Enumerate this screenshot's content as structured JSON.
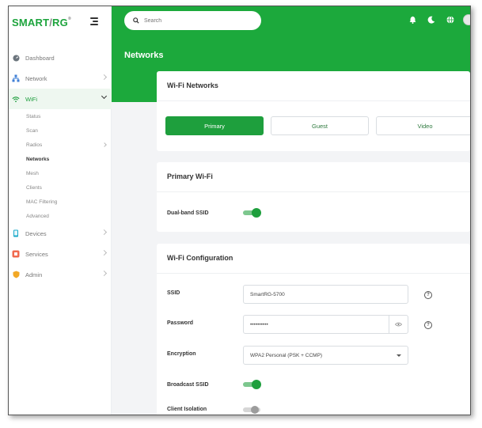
{
  "brand": {
    "logo_main": "SMART",
    "logo_slash": "/",
    "logo_tail": "RG",
    "logo_mark": "®"
  },
  "search": {
    "placeholder": "Search"
  },
  "page": {
    "title": "Networks"
  },
  "sidebar": {
    "items": [
      {
        "label": "Dashboard",
        "icon": "dashboard-icon"
      },
      {
        "label": "Network",
        "icon": "network-icon"
      },
      {
        "label": "WiFi",
        "icon": "wifi-icon"
      },
      {
        "label": "Devices",
        "icon": "devices-icon"
      },
      {
        "label": "Services",
        "icon": "services-icon"
      },
      {
        "label": "Admin",
        "icon": "admin-icon"
      }
    ],
    "wifi_sub": [
      "Status",
      "Scan",
      "Radios",
      "Networks",
      "Mesh",
      "Clients",
      "MAC Filtering",
      "Advanced"
    ]
  },
  "wifi_networks": {
    "title": "Wi-Fi Networks",
    "tabs": [
      "Primary",
      "Guest",
      "Video"
    ],
    "active_tab": "Primary"
  },
  "primary_wifi": {
    "title": "Primary Wi-Fi",
    "dual_band_label": "Dual-band SSID",
    "dual_band_on": true
  },
  "config": {
    "title": "Wi-Fi Configuration",
    "ssid_label": "SSID",
    "ssid_value": "SmartRG-5700",
    "password_label": "Password",
    "password_value": "••••••••••",
    "encryption_label": "Encryption",
    "encryption_value": "WPA2 Personal (PSK + CCMP)",
    "broadcast_label": "Broadcast SSID",
    "broadcast_on": true,
    "isolation_label": "Client Isolation",
    "isolation_on": false,
    "help_glyph": "?"
  },
  "colors": {
    "brand_green": "#1ca93c",
    "active_green": "#1e9f3d"
  }
}
